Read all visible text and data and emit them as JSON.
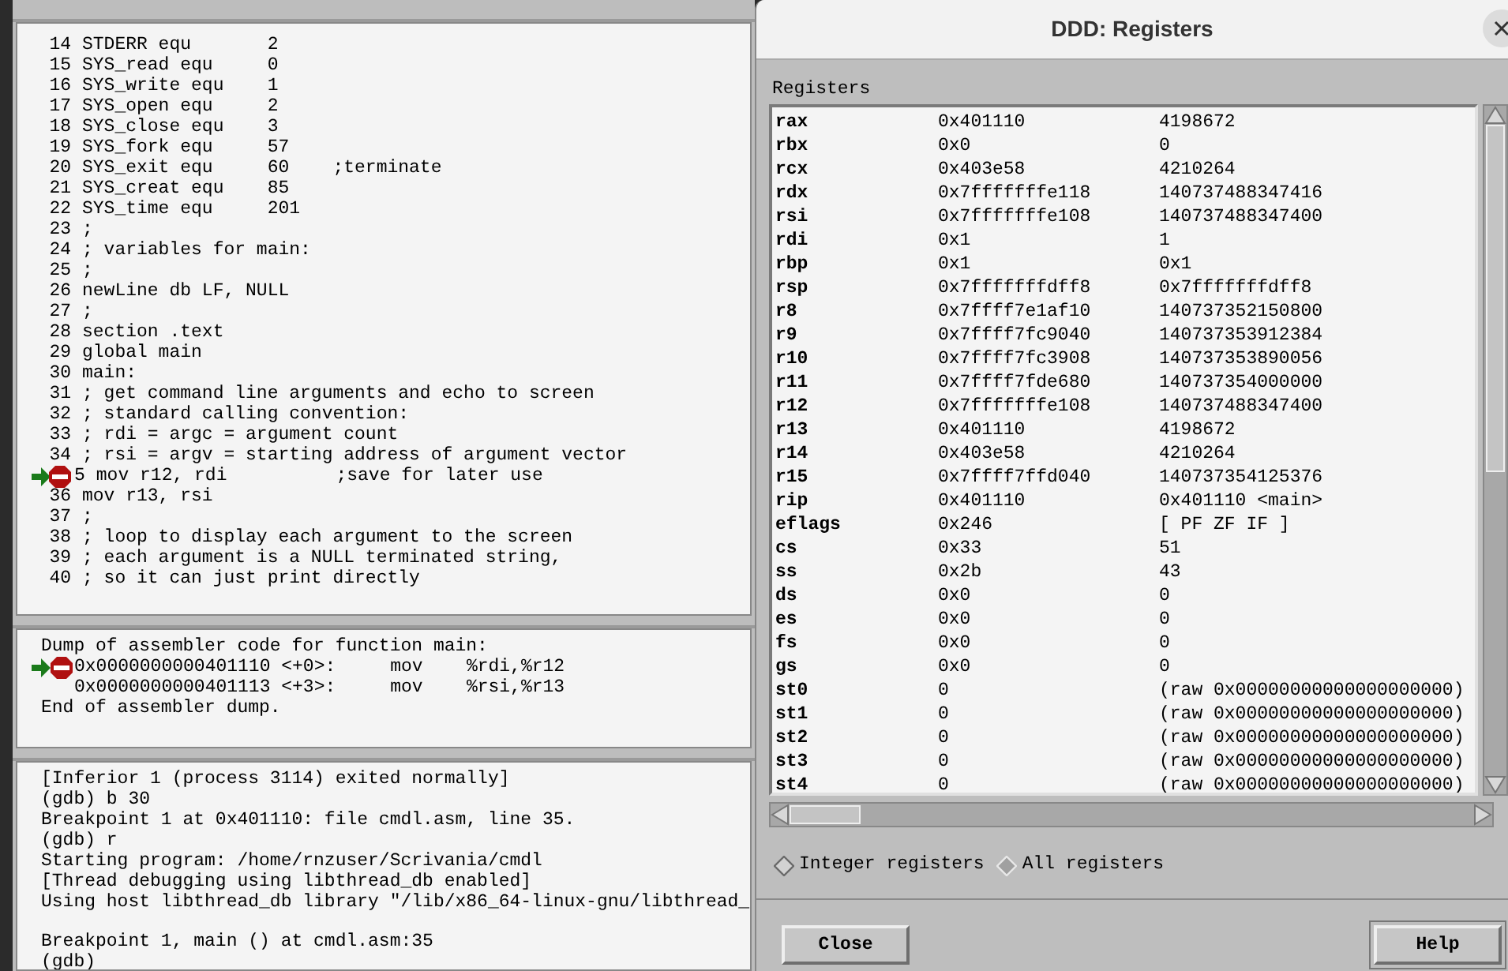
{
  "source": {
    "lines": [
      {
        "number": "14",
        "text": "STDERR equ       2",
        "breakpoint": false,
        "current": false
      },
      {
        "number": "15",
        "text": "SYS_read equ     0",
        "breakpoint": false,
        "current": false
      },
      {
        "number": "16",
        "text": "SYS_write equ    1",
        "breakpoint": false,
        "current": false
      },
      {
        "number": "17",
        "text": "SYS_open equ     2",
        "breakpoint": false,
        "current": false
      },
      {
        "number": "18",
        "text": "SYS_close equ    3",
        "breakpoint": false,
        "current": false
      },
      {
        "number": "19",
        "text": "SYS_fork equ     57",
        "breakpoint": false,
        "current": false
      },
      {
        "number": "20",
        "text": "SYS_exit equ     60    ;terminate",
        "breakpoint": false,
        "current": false
      },
      {
        "number": "21",
        "text": "SYS_creat equ    85",
        "breakpoint": false,
        "current": false
      },
      {
        "number": "22",
        "text": "SYS_time equ     201",
        "breakpoint": false,
        "current": false
      },
      {
        "number": "23",
        "text": ";",
        "breakpoint": false,
        "current": false
      },
      {
        "number": "24",
        "text": "; variables for main:",
        "breakpoint": false,
        "current": false
      },
      {
        "number": "25",
        "text": ";",
        "breakpoint": false,
        "current": false
      },
      {
        "number": "26",
        "text": "newLine db LF, NULL",
        "breakpoint": false,
        "current": false
      },
      {
        "number": "27",
        "text": ";",
        "breakpoint": false,
        "current": false
      },
      {
        "number": "28",
        "text": "section .text",
        "breakpoint": false,
        "current": false
      },
      {
        "number": "29",
        "text": "global main",
        "breakpoint": false,
        "current": false
      },
      {
        "number": "30",
        "text": "main:",
        "breakpoint": false,
        "current": false
      },
      {
        "number": "31",
        "text": "; get command line arguments and echo to screen",
        "breakpoint": false,
        "current": false
      },
      {
        "number": "32",
        "text": "; standard calling convention:",
        "breakpoint": false,
        "current": false
      },
      {
        "number": "33",
        "text": "; rdi = argc = argument count",
        "breakpoint": false,
        "current": false
      },
      {
        "number": "34",
        "text": "; rsi = argv = starting address of argument vector",
        "breakpoint": false,
        "current": false
      },
      {
        "number": "5",
        "text": "mov r12, rdi          ;save for later use",
        "breakpoint": true,
        "current": true
      },
      {
        "number": "36",
        "text": "mov r13, rsi",
        "breakpoint": false,
        "current": false
      },
      {
        "number": "37",
        "text": ";",
        "breakpoint": false,
        "current": false
      },
      {
        "number": "38",
        "text": "; loop to display each argument to the screen",
        "breakpoint": false,
        "current": false
      },
      {
        "number": "39",
        "text": "; each argument is a NULL terminated string,",
        "breakpoint": false,
        "current": false
      },
      {
        "number": "40",
        "text": "; so it can just print directly",
        "breakpoint": false,
        "current": false
      }
    ]
  },
  "disassembly": {
    "lines": [
      {
        "kind": "text",
        "text": "Dump of assembler code for function main:"
      },
      {
        "kind": "instruction",
        "text": "0x0000000000401110 <+0>:     mov    %rdi,%r12",
        "breakpoint": true,
        "current": true
      },
      {
        "kind": "instruction",
        "text": "0x0000000000401113 <+3>:     mov    %rsi,%r13",
        "breakpoint": false,
        "current": false
      },
      {
        "kind": "text",
        "text": "End of assembler dump."
      }
    ]
  },
  "console": {
    "blocks": [
      [
        "[Inferior 1 (process 3114) exited normally]",
        "(gdb) b 30",
        "Breakpoint 1 at 0x401110: file cmdl.asm, line 35.",
        "(gdb) r",
        "Starting program: /home/rnzuser/Scrivania/cmdl",
        "[Thread debugging using libthread_db enabled]",
        "Using host libthread_db library \"/lib/x86_64-linux-gnu/libthread_"
      ],
      [
        "Breakpoint 1, main () at cmdl.asm:35",
        "(gdb)"
      ]
    ]
  },
  "dialog": {
    "title": "DDD: Registers",
    "label": "Registers",
    "registers": [
      {
        "name": "rax",
        "raw": "0x401110",
        "natural": "4198672"
      },
      {
        "name": "rbx",
        "raw": "0x0",
        "natural": "0"
      },
      {
        "name": "rcx",
        "raw": "0x403e58",
        "natural": "4210264"
      },
      {
        "name": "rdx",
        "raw": "0x7fffffffe118",
        "natural": "140737488347416"
      },
      {
        "name": "rsi",
        "raw": "0x7fffffffe108",
        "natural": "140737488347400"
      },
      {
        "name": "rdi",
        "raw": "0x1",
        "natural": "1"
      },
      {
        "name": "rbp",
        "raw": "0x1",
        "natural": "0x1"
      },
      {
        "name": "rsp",
        "raw": "0x7fffffffdff8",
        "natural": "0x7fffffffdff8"
      },
      {
        "name": "r8",
        "raw": "0x7ffff7e1af10",
        "natural": "140737352150800"
      },
      {
        "name": "r9",
        "raw": "0x7ffff7fc9040",
        "natural": "140737353912384"
      },
      {
        "name": "r10",
        "raw": "0x7ffff7fc3908",
        "natural": "140737353890056"
      },
      {
        "name": "r11",
        "raw": "0x7ffff7fde680",
        "natural": "140737354000000"
      },
      {
        "name": "r12",
        "raw": "0x7fffffffe108",
        "natural": "140737488347400"
      },
      {
        "name": "r13",
        "raw": "0x401110",
        "natural": "4198672"
      },
      {
        "name": "r14",
        "raw": "0x403e58",
        "natural": "4210264"
      },
      {
        "name": "r15",
        "raw": "0x7ffff7ffd040",
        "natural": "140737354125376"
      },
      {
        "name": "rip",
        "raw": "0x401110",
        "natural": "0x401110 <main>"
      },
      {
        "name": "eflags",
        "raw": "0x246",
        "natural": "[ PF ZF IF ]"
      },
      {
        "name": "cs",
        "raw": "0x33",
        "natural": "51"
      },
      {
        "name": "ss",
        "raw": "0x2b",
        "natural": "43"
      },
      {
        "name": "ds",
        "raw": "0x0",
        "natural": "0"
      },
      {
        "name": "es",
        "raw": "0x0",
        "natural": "0"
      },
      {
        "name": "fs",
        "raw": "0x0",
        "natural": "0"
      },
      {
        "name": "gs",
        "raw": "0x0",
        "natural": "0"
      },
      {
        "name": "st0",
        "raw": "0",
        "natural": "(raw 0x00000000000000000000)"
      },
      {
        "name": "st1",
        "raw": "0",
        "natural": "(raw 0x00000000000000000000)"
      },
      {
        "name": "st2",
        "raw": "0",
        "natural": "(raw 0x00000000000000000000)"
      },
      {
        "name": "st3",
        "raw": "0",
        "natural": "(raw 0x00000000000000000000)"
      },
      {
        "name": "st4",
        "raw": "0",
        "natural": "(raw 0x00000000000000000000)"
      }
    ],
    "options": [
      {
        "label": "Integer registers",
        "selected": false
      },
      {
        "label": "All registers",
        "selected": true
      }
    ],
    "buttons": [
      "Close",
      "Help"
    ]
  }
}
